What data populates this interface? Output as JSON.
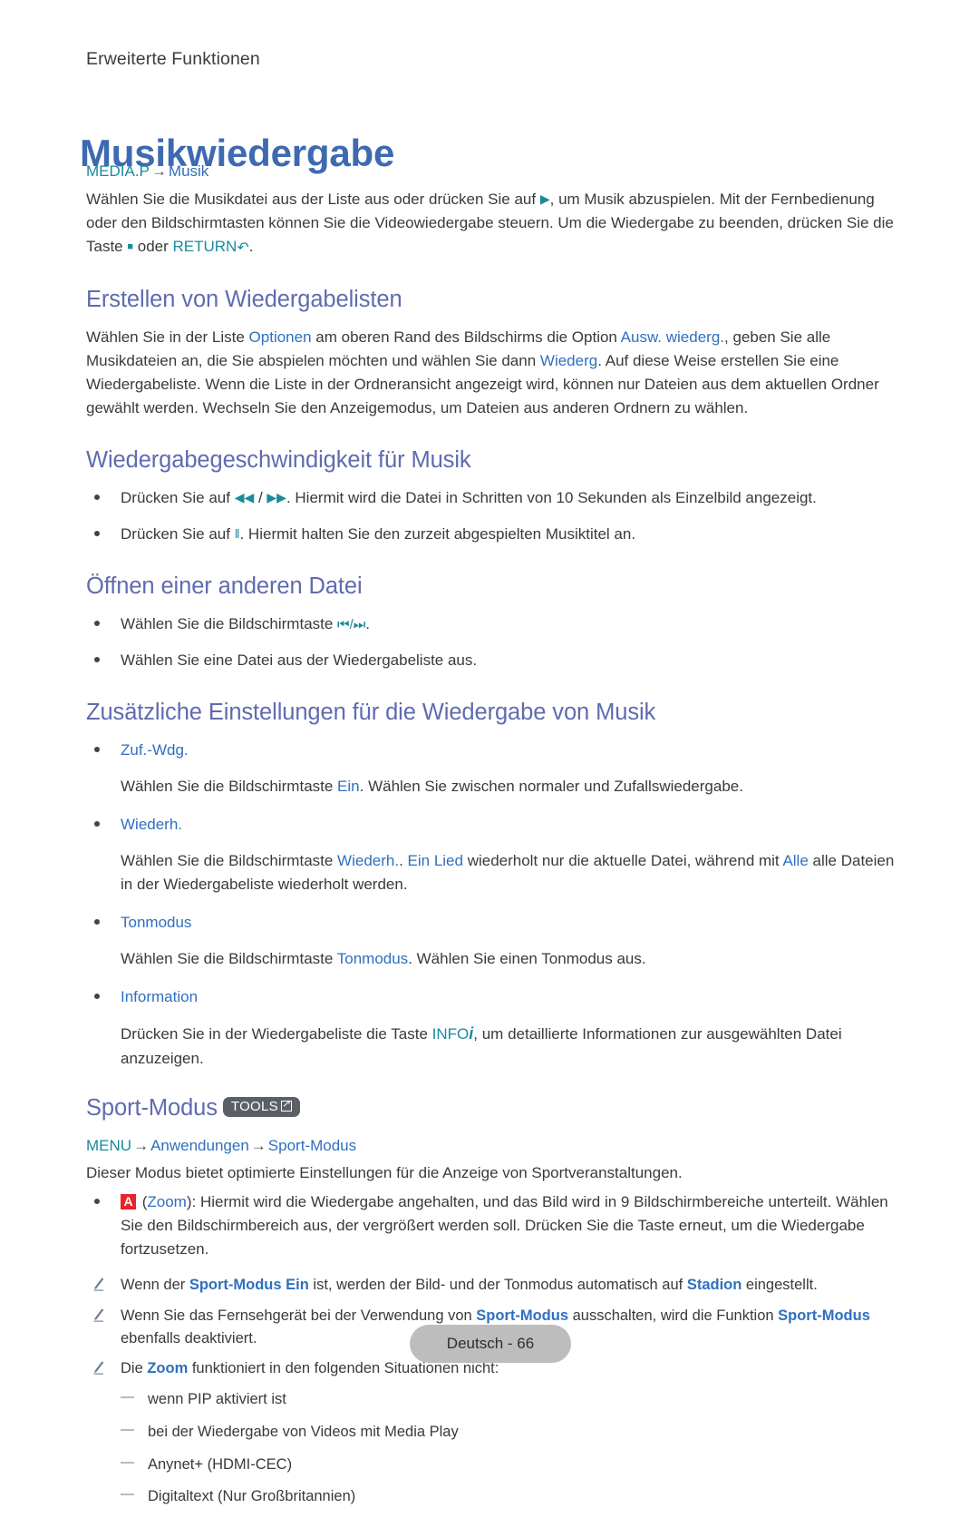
{
  "header": {
    "running_head": "Erweiterte Funktionen",
    "title": "Musikwiedergabe"
  },
  "breadcrumb_music": {
    "root": "MEDIA.P",
    "arrow": "→",
    "leaf": "Musik"
  },
  "intro": {
    "part1": "Wählen Sie die Musikdatei aus der Liste aus oder drücken Sie auf ",
    "play_glyph": "▶",
    "part2": ", um Musik abzuspielen. Mit der Fernbedienung oder den Bildschirmtasten können Sie die Videowiedergabe steuern. Um die Wiedergabe zu beenden, drücken Sie die Taste ",
    "stop_glyph": "■",
    "part3": " oder ",
    "return_label": "RETURN",
    "return_glyph": "↶",
    "part4": "."
  },
  "section_playlists": {
    "heading": "Erstellen von Wiedergabelisten",
    "p1": "Wählen Sie in der Liste ",
    "term_optionen": "Optionen",
    "p2": " am oberen Rand des Bildschirms die Option ",
    "term_ausw": "Ausw. wiederg.",
    "p3": ", geben Sie alle Musikdateien an, die Sie abspielen möchten und wählen Sie dann ",
    "term_wiederg": "Wiederg",
    "p4": ". Auf diese Weise erstellen Sie eine Wiedergabeliste. Wenn die Liste in der Ordneransicht angezeigt wird, können nur Dateien aus dem aktuellen Ordner gewählt werden. Wechseln Sie den Anzeigemodus, um Dateien aus anderen Ordnern zu wählen."
  },
  "section_speed": {
    "heading": "Wiedergabegeschwindigkeit für Musik",
    "b1_pre": "Drücken Sie auf ",
    "b1_glyph_rew": "◀◀",
    "b1_sep": " / ",
    "b1_glyph_ff": "▶▶",
    "b1_post": ". Hiermit wird die Datei in Schritten von 10 Sekunden als Einzelbild angezeigt.",
    "b2_pre": "Drücken Sie auf ",
    "b2_glyph_pause": "‖",
    "b2_post": ". Hiermit halten Sie den zurzeit abgespielten Musiktitel an."
  },
  "section_open": {
    "heading": "Öffnen einer anderen Datei",
    "b1_pre": "Wählen Sie die Bildschirmtaste ",
    "b1_glyph_prev": "⏮",
    "b1_sep": "/",
    "b1_glyph_next": "⏭",
    "b1_post": ".",
    "b2": "Wählen Sie eine Datei aus der Wiedergabeliste aus."
  },
  "section_extra": {
    "heading": "Zusätzliche Einstellungen für die Wiedergabe von Musik",
    "items": [
      {
        "title": "Zuf.-Wdg.",
        "body_pre": "Wählen Sie die Bildschirmtaste ",
        "term1": "Ein",
        "body_post": ". Wählen Sie zwischen normaler und Zufallswiedergabe."
      },
      {
        "title": "Wiederh.",
        "body_pre": "Wählen Sie die Bildschirmtaste ",
        "term1": "Wiederh.",
        "body_mid1": ". ",
        "term2": "Ein Lied",
        "body_mid2": " wiederholt nur die aktuelle Datei, während mit ",
        "term3": "Alle",
        "body_post": " alle Dateien in der Wiedergabeliste wiederholt werden."
      },
      {
        "title": "Tonmodus",
        "body_pre": "Wählen Sie die Bildschirmtaste ",
        "term1": "Tonmodus",
        "body_post": ". Wählen Sie einen Tonmodus aus."
      },
      {
        "title": "Information",
        "body_pre": "Drücken Sie in der Wiedergabeliste die Taste ",
        "term1": "INFO",
        "term1_glyph": "i",
        "body_post": ", um detaillierte Informationen zur ausgewählten Datei anzuzeigen."
      }
    ]
  },
  "section_sport": {
    "heading": "Sport-Modus",
    "tools_badge": "TOOLS",
    "breadcrumb": {
      "root": "MENU",
      "arrow1": "→",
      "mid": "Anwendungen",
      "arrow2": "→",
      "leaf": "Sport-Modus"
    },
    "intro": "Dieser Modus bietet optimierte Einstellungen für die Anzeige von Sportveranstaltungen.",
    "zoom_bullet": {
      "badge": "A",
      "open_paren": " (",
      "term": "Zoom",
      "close": "): Hiermit wird die Wiedergabe angehalten, und das Bild wird in 9 Bildschirmbereiche unterteilt. Wählen Sie den Bildschirmbereich aus, der vergrößert werden soll. Drücken Sie die Taste erneut, um die Wiedergabe fortzusetzen."
    },
    "notes": [
      {
        "pre": "Wenn der ",
        "term1": "Sport-Modus Ein",
        "mid": " ist, werden der Bild- und der Tonmodus automatisch auf ",
        "term2": "Stadion",
        "post": " eingestellt."
      },
      {
        "pre": "Wenn Sie das Fernsehgerät bei der Verwendung von ",
        "term1": "Sport-Modus",
        "mid": " ausschalten, wird die Funktion ",
        "term2": "Sport-Modus",
        "post": " ebenfalls deaktiviert."
      },
      {
        "pre": "Die ",
        "term1": "Zoom",
        "mid": " funktioniert in den folgenden Situationen nicht:",
        "term2": "",
        "post": ""
      }
    ],
    "dash_items": [
      "wenn PIP aktiviert ist",
      "bei der Wiedergabe von Videos mit Media Play",
      "Anynet+ (HDMI-CEC)",
      "Digitaltext (Nur Großbritannien)"
    ]
  },
  "footer": {
    "page_label": "Deutsch - 66"
  },
  "colors": {
    "title_blue": "#3d6ab0",
    "section_blue": "#5f6bb0",
    "link_blue": "#2f6fbf",
    "teal": "#1a8a9c",
    "badge_gray": "#5a6066",
    "red": "#e8232a",
    "footer_gray": "#bdbdbd",
    "dash_gray": "#8a6e6a"
  }
}
